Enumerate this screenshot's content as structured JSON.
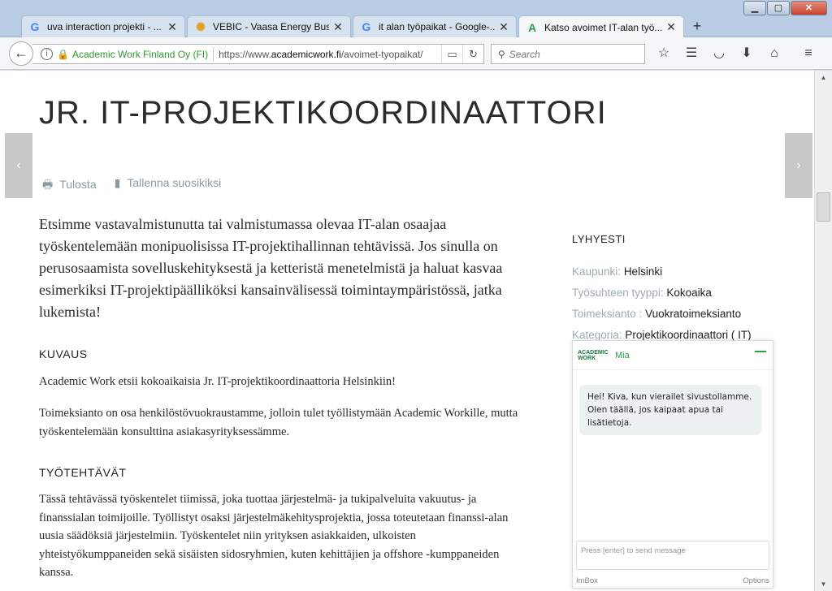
{
  "browser": {
    "tabs": [
      {
        "label": "uva interaction projekti - ...",
        "icon": "G"
      },
      {
        "label": "VEBIC - Vaasa Energy Busi...",
        "icon": "✺"
      },
      {
        "label": "it alan työpaikat - Google-...",
        "icon": "G"
      },
      {
        "label": "Katso avoimet IT-alan työ...",
        "icon": "A"
      }
    ],
    "new_tab": "+",
    "window_buttons": {
      "minimize": "▁",
      "maximize": "▢",
      "close": "✕"
    },
    "org": "Academic Work Finland Oy (FI)",
    "url_prefix": "https://www.",
    "url_domain": "academicwork.fi",
    "url_path": "/avoimet-tyopaikat/",
    "search_placeholder": "Search"
  },
  "page": {
    "title": "JR. IT-PROJEKTIKOORDINAATTORI",
    "prev_arrow": "‹",
    "next_arrow": "›",
    "print_label": "Tulosta",
    "save_label": "Tallenna suosikiksi",
    "lead": "Etsimme vastavalmistunutta tai valmistumassa olevaa IT-alan osaajaa työskentelemään monipuolisissa IT-projektihallinnan tehtävissä. Jos sinulla on perusosaamista sovelluskehityksestä ja ketteristä menetelmistä ja haluat kasvaa esimerkiksi IT-projektipäälliköksi kansainvälisessä toimintaympäristössä, jatka lukemista!",
    "section1_title": "KUVAUS",
    "section1_p1": "Academic Work etsii kokoaikaisia Jr. IT-projektikoordinaattoria Helsinkiin!",
    "section1_p2": "Toimeksianto on osa henkilöstövuokraustamme, jolloin tulet työllistymään Academic Workille, mutta työskentelemään konsulttina asiakasyrityksessämme.",
    "section2_title": "TYÖTEHTÄVÄT",
    "section2_p1": "Tässä tehtävässä työskentelet tiimissä, joka tuottaa järjestelmä- ja tukipalveluita vakuutus- ja finanssialan toimijoille. Työllistyt osaksi järjestelmäkehitysprojektia, jossa toteutetaan finanssi-alan uusia säädöksiä järjestelmiin. Työskentelet niin yrityksen asiakkaiden, ulkoisten yhteistyökumppaneiden sekä sisäisten sidosryhmien, kuten kehittäjien ja offshore -kumppaneiden kanssa."
  },
  "summary": {
    "heading": "LYHYESTI",
    "rows": [
      {
        "key": "Kaupunki:",
        "value": "Helsinki"
      },
      {
        "key": "Työsuhteen tyyppi:",
        "value": "Kokoaika"
      },
      {
        "key": "Toimeksianto :",
        "value": "Vuokratoimeksianto"
      },
      {
        "key": "Kategoria:",
        "value": "Projektikoordinaattori ( IT)"
      }
    ]
  },
  "chat": {
    "logo": "ACADEMIC WORK",
    "agent": "Mia",
    "message": "Hei! Kiva, kun vierailet sivustollamme. Olen täällä, jos kaipaat apua tai lisätietoja.",
    "input_placeholder": "Press [enter] to send message",
    "brand": "ImBox",
    "options": "Options"
  }
}
